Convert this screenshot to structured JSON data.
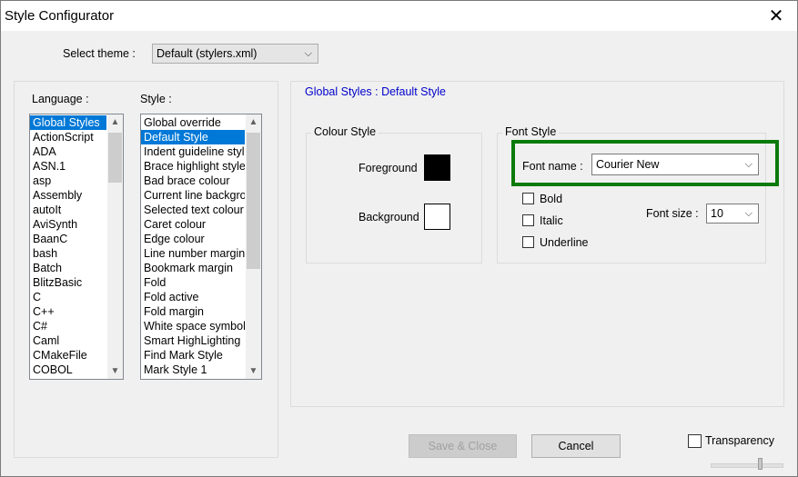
{
  "window": {
    "title": "Style Configurator"
  },
  "theme": {
    "label": "Select theme :",
    "value": "Default (stylers.xml)"
  },
  "language": {
    "label": "Language :",
    "items": [
      "Global Styles",
      "ActionScript",
      "ADA",
      "ASN.1",
      "asp",
      "Assembly",
      "autoIt",
      "AviSynth",
      "BaanC",
      "bash",
      "Batch",
      "BlitzBasic",
      "C",
      "C++",
      "C#",
      "Caml",
      "CMakeFile",
      "COBOL"
    ]
  },
  "style": {
    "label": "Style :",
    "items": [
      "Global override",
      "Default Style",
      "Indent guideline style",
      "Brace highlight style",
      "Bad brace colour",
      "Current line background",
      "Selected text colour",
      "Caret colour",
      "Edge colour",
      "Line number margin",
      "Bookmark margin",
      "Fold",
      "Fold active",
      "Fold margin",
      "White space symbol",
      "Smart HighLighting",
      "Find Mark Style",
      "Mark Style 1"
    ]
  },
  "header": {
    "breadcrumb": "Global Styles : Default Style"
  },
  "colour_style": {
    "title": "Colour Style",
    "foreground_label": "Foreground",
    "background_label": "Background",
    "foreground_color": "#000000",
    "background_color": "#ffffff"
  },
  "font_style": {
    "title": "Font Style",
    "font_name_label": "Font name :",
    "font_name_value": "Courier New",
    "bold_label": "Bold",
    "italic_label": "Italic",
    "underline_label": "Underline",
    "font_size_label": "Font size :",
    "font_size_value": "10"
  },
  "buttons": {
    "save_close": "Save & Close",
    "cancel": "Cancel"
  },
  "transparency": {
    "label": "Transparency"
  },
  "colors": {
    "selection": "#0078d7",
    "highlight_border": "#0a7a0a",
    "breadcrumb": "#0000cc"
  }
}
